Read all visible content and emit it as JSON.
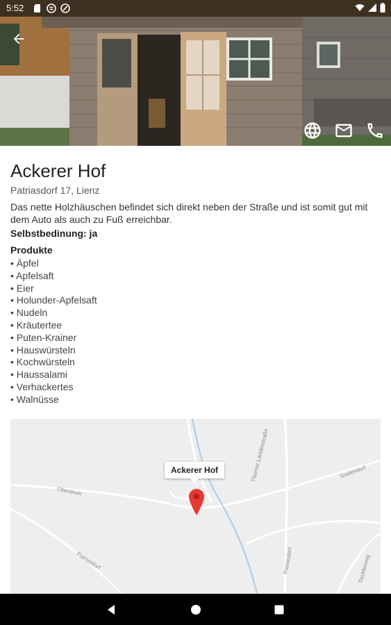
{
  "status_bar": {
    "time": "5:52",
    "left_icons": [
      "sd-card-icon",
      "notification-icon",
      "circle-icon"
    ],
    "right_icons": [
      "wifi-icon",
      "signal-icon",
      "battery-icon"
    ]
  },
  "hero": {
    "back_icon": "arrow-back-icon",
    "actions": [
      "globe-icon",
      "mail-icon",
      "phone-icon"
    ]
  },
  "place": {
    "name": "Ackerer Hof",
    "address": "Patriasdorf 17, Lienz",
    "description": "Das nette Holzhäuschen befindet sich direkt neben der Straße und ist somit gut mit dem Auto als auch zu Fuß erreichbar.",
    "selfservice_label": "Selbstbedinung: ja",
    "products_heading": "Produkte",
    "products": [
      "Äpfel",
      "Apfelsaft",
      "Eier",
      "Holunder-Apfelsaft",
      "Nudeln",
      "Kräutertee",
      "Puten-Krainer",
      "Hauswürsteln",
      "Kochwürsteln",
      "Haussalami",
      "Verhackertes",
      "Walnüsse"
    ]
  },
  "map": {
    "marker_title": "Ackerer Hof",
    "street_labels": {
      "oberdrum": "Oberdrum",
      "patriasdorf": "Patriasdorf",
      "landesstrasse": "Thurner Landesstraße",
      "grafendorf": "Grafendorf",
      "patriasdorf2": "Patriasdorf",
      "tischlerweg": "Tischlerweg"
    },
    "pin_color": "#e53935"
  },
  "nav_bar": {
    "buttons": [
      "back-triangle-icon",
      "home-circle-icon",
      "recents-square-icon"
    ]
  },
  "colors": {
    "status_bar": "#3e3020",
    "nav_bar": "#000000"
  }
}
